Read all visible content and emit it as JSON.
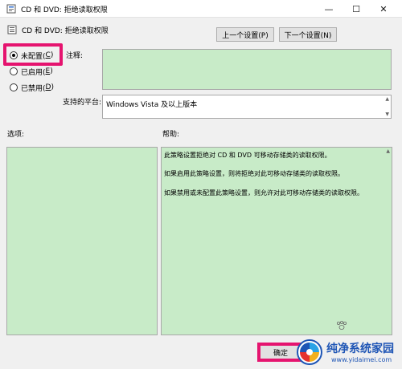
{
  "window": {
    "title": "CD 和 DVD: 拒绝读取权限",
    "minimize": "—",
    "maximize": "☐",
    "close": "✕"
  },
  "policy": {
    "title": "CD 和 DVD: 拒绝读取权限"
  },
  "nav": {
    "prev": "上一个设置(P)",
    "next": "下一个设置(N)"
  },
  "radios": [
    {
      "label": "未配置(",
      "key": "C",
      "tail": ")",
      "checked": true
    },
    {
      "label": "已启用(",
      "key": "E",
      "tail": ")",
      "checked": false
    },
    {
      "label": "已禁用(",
      "key": "D",
      "tail": ")",
      "checked": false
    }
  ],
  "labels": {
    "comment": "注释:",
    "platform": "支持的平台:",
    "options": "选项:",
    "help": "帮助:"
  },
  "platform_value": "Windows Vista 及以上版本",
  "help_text": [
    "此策略设置拒绝对 CD 和 DVD 可移动存储类的读取权限。",
    "如果启用此策略设置，则将拒绝对此可移动存储类的读取权限。",
    "如果禁用或未配置此策略设置，则允许对此可移动存储类的读取权限。"
  ],
  "buttons": {
    "ok": "确定"
  },
  "watermark": {
    "name": "纯净系统家园",
    "url": "www.yidaimei.com"
  },
  "colors": {
    "accent_highlight": "#e5146f",
    "pane_green": "#c8ebc8",
    "watermark_blue": "#1e55b5"
  }
}
